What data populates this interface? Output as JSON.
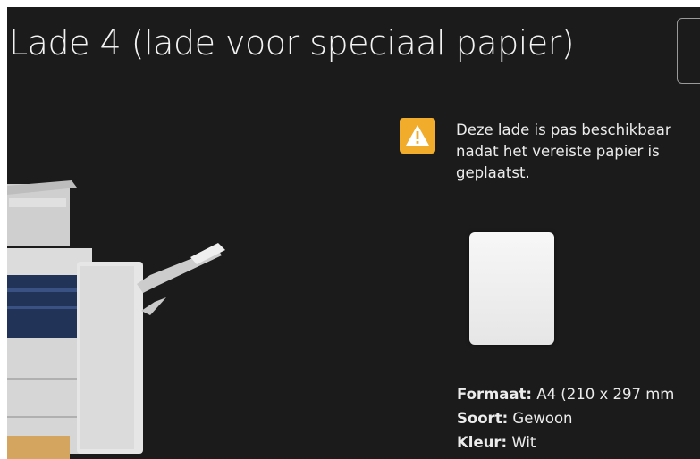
{
  "title": "Lade 4 (lade voor speciaal papier)",
  "warning": {
    "icon": "warning-icon",
    "message": "Deze lade is pas beschikbaar nadat het vereiste papier is geplaatst."
  },
  "paper": {
    "properties": [
      {
        "label": "Formaat:",
        "value": " A4 (210 x 297 mm"
      },
      {
        "label": "Soort:",
        "value": " Gewoon"
      },
      {
        "label": "Kleur:",
        "value": " Wit"
      }
    ]
  },
  "colors": {
    "background": "#1b1b1b",
    "warning_accent": "#f0ac2a",
    "text": "#ececec"
  }
}
